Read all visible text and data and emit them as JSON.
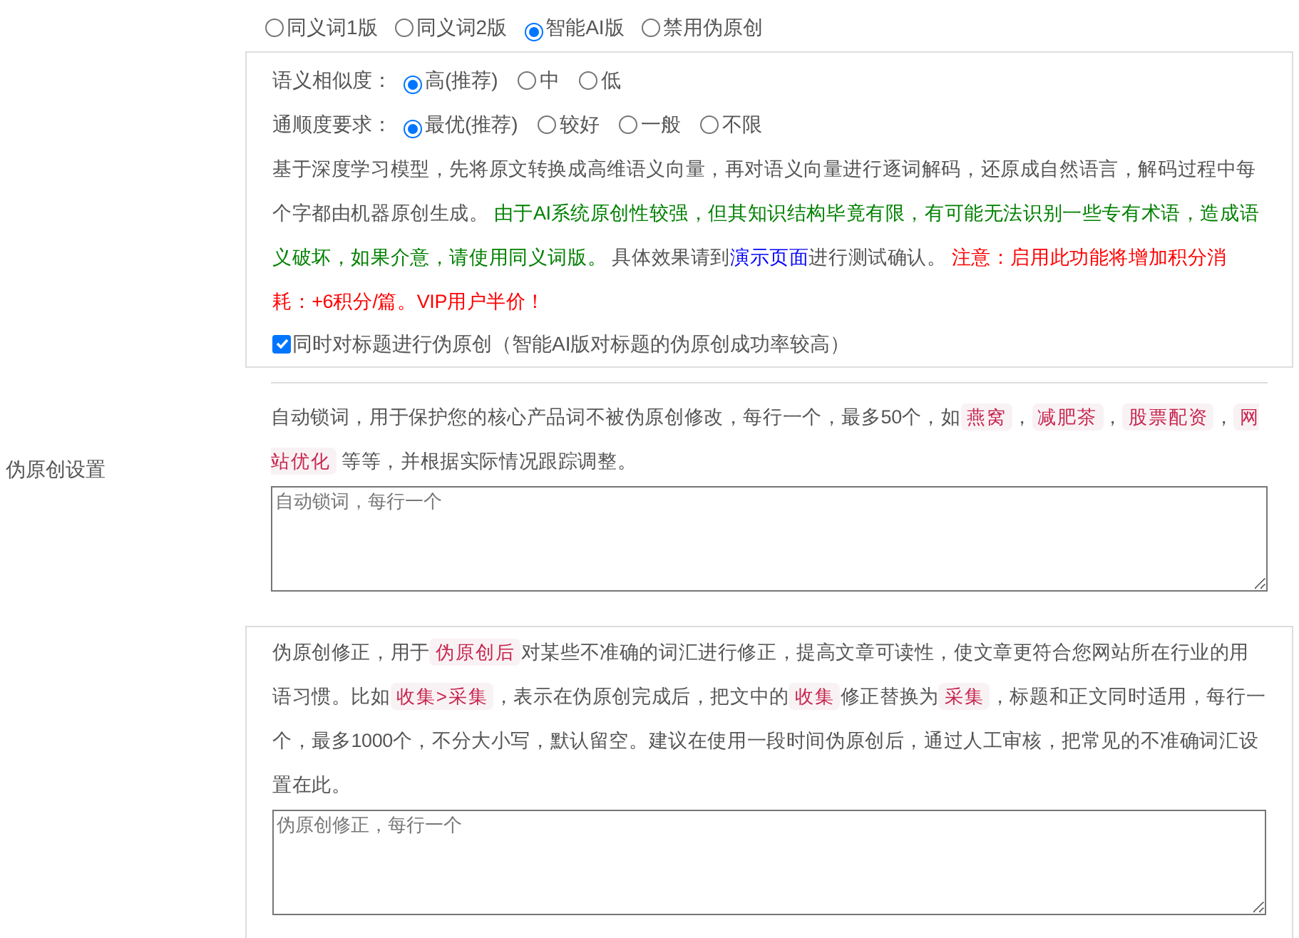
{
  "section_label": "伪原创设置",
  "modes": [
    {
      "label": "同义词1版",
      "selected": false
    },
    {
      "label": "同义词2版",
      "selected": false
    },
    {
      "label": "智能AI版",
      "selected": true
    },
    {
      "label": "禁用伪原创",
      "selected": false
    }
  ],
  "ai_settings": {
    "groups": [
      {
        "label": "语义相似度：",
        "options": [
          {
            "label": "高(推荐)",
            "selected": true
          },
          {
            "label": "中",
            "selected": false
          },
          {
            "label": "低",
            "selected": false
          }
        ]
      },
      {
        "label": "通顺度要求：",
        "options": [
          {
            "label": "最优(推荐)",
            "selected": true
          },
          {
            "label": "较好",
            "selected": false
          },
          {
            "label": "一般",
            "selected": false
          },
          {
            "label": "不限",
            "selected": false
          }
        ]
      }
    ],
    "description": [
      {
        "kind": "text",
        "text": "基于深度学习模型，先将原文转换成高维语义向量，再对语义向量进行逐词解码，还原成自然语言，解码过程中每个字都由机器原创生成。 "
      },
      {
        "kind": "success",
        "text": "由于AI系统原创性较强，但其知识结构毕竟有限，有可能无法识别一些专有术语，造成语义破坏，如果介意，请使用同义词版。"
      },
      {
        "kind": "text",
        "text": " 具体效果请到"
      },
      {
        "kind": "link",
        "text": "演示页面"
      },
      {
        "kind": "text",
        "text": "进行测试确认。 "
      },
      {
        "kind": "warning",
        "text": "注意：启用此功能将增加积分消耗：+6积分/篇。VIP用户半价！"
      }
    ],
    "title_checkbox": {
      "label": "同时对标题进行伪原创（智能AI版对标题的伪原创成功率较高）",
      "checked": true
    }
  },
  "lock_words": {
    "description": [
      {
        "kind": "text",
        "text": "自动锁词，用于保护您的核心产品词不被伪原创修改，每行一个，最多50个，如"
      },
      {
        "kind": "tag",
        "text": "燕窝"
      },
      {
        "kind": "text",
        "text": "，"
      },
      {
        "kind": "tag",
        "text": "减肥茶"
      },
      {
        "kind": "text",
        "text": "，"
      },
      {
        "kind": "tag",
        "text": "股票配资"
      },
      {
        "kind": "text",
        "text": "，"
      },
      {
        "kind": "tag",
        "text": "网站优化"
      },
      {
        "kind": "text",
        "text": " 等等，并根据实际情况跟踪调整。"
      }
    ],
    "placeholder": "自动锁词，每行一个"
  },
  "corrections": {
    "description": [
      {
        "kind": "text",
        "text": "伪原创修正，用于"
      },
      {
        "kind": "tag",
        "text": "伪原创后"
      },
      {
        "kind": "text",
        "text": "对某些不准确的词汇进行修正，提高文章可读性，使文章更符合您网站所在行业的用语习惯。比如"
      },
      {
        "kind": "tag",
        "text": "收集>采集"
      },
      {
        "kind": "text",
        "text": "，表示在伪原创完成后，把文中的"
      },
      {
        "kind": "tag",
        "text": "收集"
      },
      {
        "kind": "text",
        "text": "修正替换为"
      },
      {
        "kind": "tag",
        "text": "采集"
      },
      {
        "kind": "text",
        "text": "，标题和正文同时适用，每行一个，最多1000个，不分大小写，默认留空。建议在使用一段时间伪原创后，通过人工审核，把常见的不准确词汇设置在此。"
      }
    ],
    "placeholder": "伪原创修正，每行一个"
  }
}
